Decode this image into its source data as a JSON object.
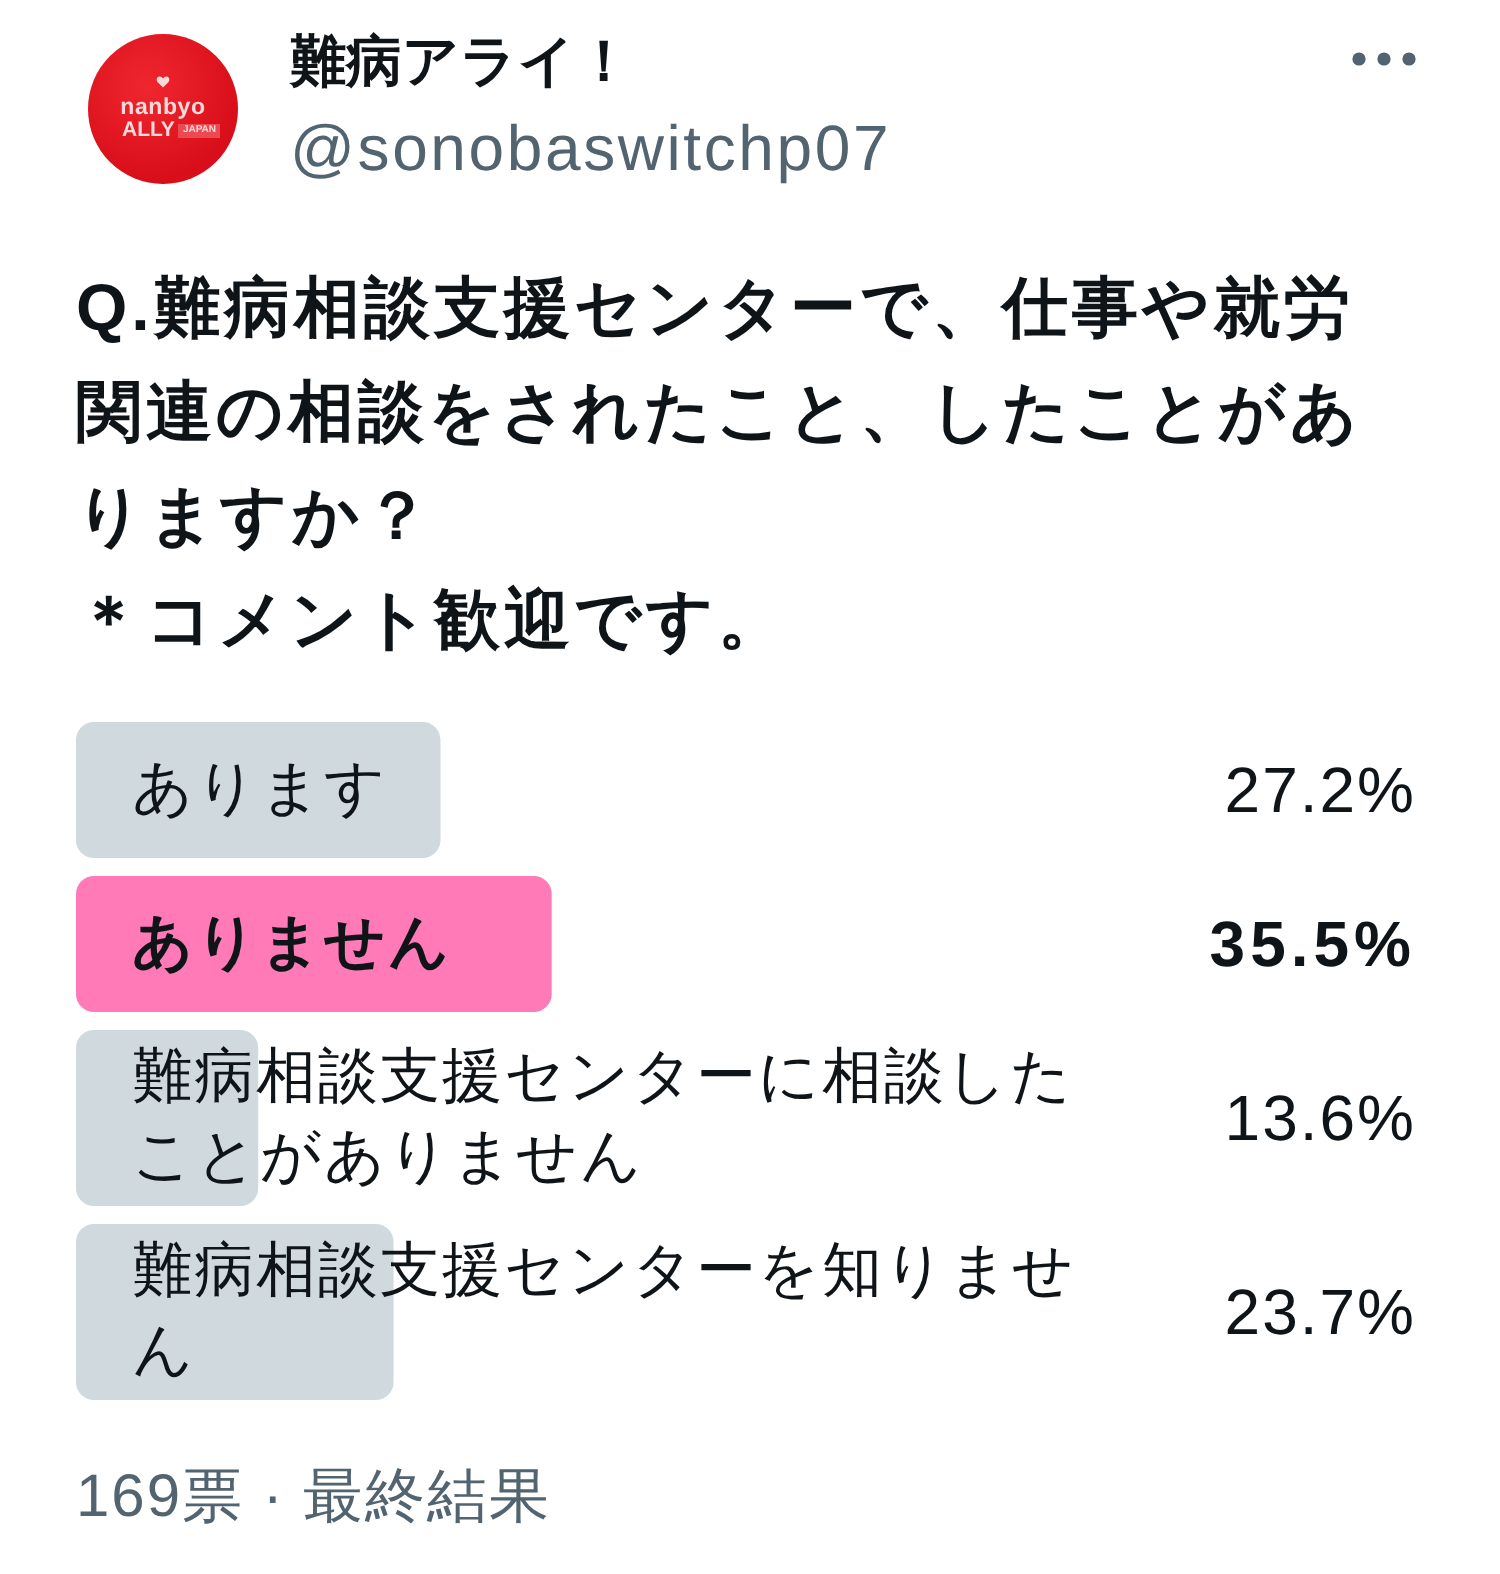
{
  "post": {
    "author": {
      "name": "難病アライ！",
      "handle": "@sonobaswitchp07",
      "avatar": {
        "logo_line_1": "nanbyo",
        "logo_line_2": "ALLY",
        "logo_badge": "JAPAN"
      }
    },
    "text_lines": [
      "Q.難病相談支援センターで、仕事や就労関連の相談をされたこと、したことがありますか？",
      "＊コメント歓迎です。"
    ]
  },
  "poll": {
    "options": [
      {
        "label": "あります",
        "percentage": "27.2%",
        "level": 0.272,
        "winner": false
      },
      {
        "label": "ありません",
        "percentage": "35.5%",
        "level": 0.355,
        "winner": true
      },
      {
        "label": "難病相談支援センターに相談したことがありません",
        "percentage": "13.6%",
        "level": 0.136,
        "winner": false
      },
      {
        "label": "難病相談支援センターを知りません",
        "percentage": "23.7%",
        "level": 0.237,
        "winner": false
      }
    ],
    "footer": "169票 · 最終結果"
  }
}
